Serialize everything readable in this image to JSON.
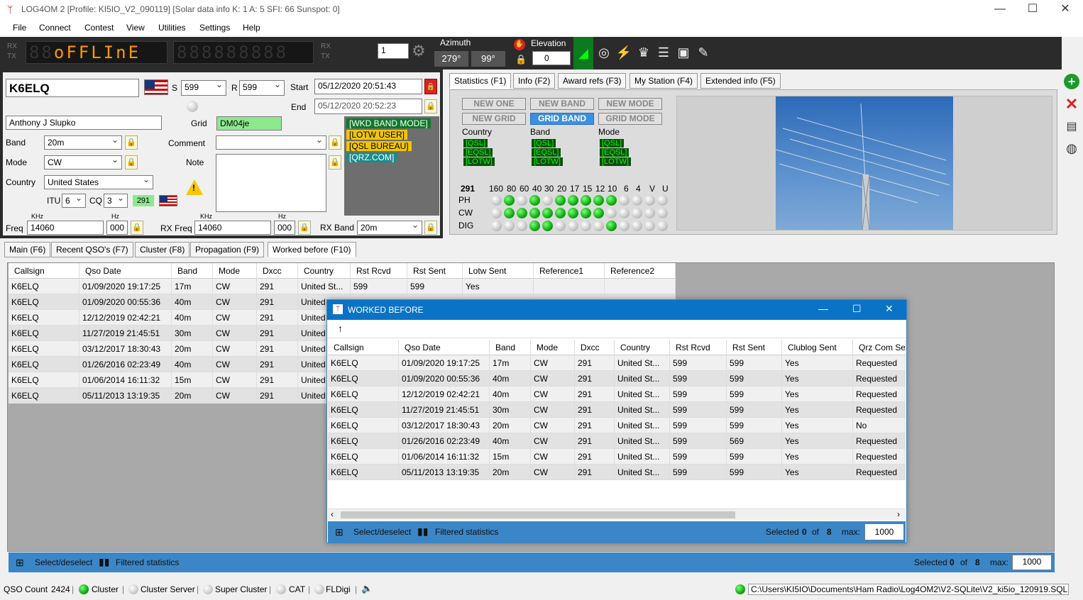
{
  "window": {
    "title": "LOG4OM 2 [Profile: KI5IO_V2_090119] [Solar data info K: 1 A: 5 SFI: 66 Sunspot: 0]"
  },
  "menu": [
    "File",
    "Connect",
    "Contest",
    "View",
    "Utilities",
    "Settings",
    "Help"
  ],
  "toolbar": {
    "rx": "RX",
    "tx": "TX",
    "display1_dim": "88",
    "display1_text": "oFFLInE",
    "display2": "888888888",
    "step_value": "1",
    "azimuth_label": "Azimuth",
    "azimuth_short": "279°",
    "azimuth_long": "99°",
    "elevation_label": "Elevation",
    "elevation_value": "0"
  },
  "qso": {
    "callsign": "K6ELQ",
    "s_label": "S",
    "s_value": "599",
    "r_label": "R",
    "r_value": "599",
    "start_label": "Start",
    "start_value": "05/12/2020 20:51:43",
    "end_label": "End",
    "end_value": "05/12/2020 20:52:23",
    "name": "Anthony J Slupko",
    "grid_label": "Grid",
    "grid_value": "DM04je",
    "band_label": "Band",
    "band_value": "20m",
    "comment_label": "Comment",
    "mode_label": "Mode",
    "mode_value": "CW",
    "note_label": "Note",
    "country_label": "Country",
    "country_value": "United States",
    "itu_label": "ITU",
    "itu_value": "6",
    "cq_label": "CQ",
    "cq_value": "3",
    "dxcc": "291",
    "khz": "KHz",
    "hz": "Hz",
    "freq_label": "Freq",
    "freq_value": "14060",
    "freq_hz": "000",
    "rxfreq_label": "RX Freq",
    "rxfreq_value": "14060",
    "rxfreq_hz": "000",
    "rxband_label": "RX Band",
    "rxband_value": "20m"
  },
  "status_badges": [
    {
      "text": "[WKD BAND MODE]",
      "bg": "#0d7a2a",
      "fg": "#ffffff"
    },
    {
      "text": "[LOTW USER]",
      "bg": "#f2c500",
      "fg": "#000000"
    },
    {
      "text": "[QSL BUREAU]",
      "bg": "#f2c500",
      "fg": "#000000"
    },
    {
      "text": "[QRZ.COM]",
      "bg": "#1a8c8c",
      "fg": "#ffffff"
    }
  ],
  "right_tabs": [
    "Statistics (F1)",
    "Info (F2)",
    "Award refs (F3)",
    "My Station (F4)",
    "Extended info (F5)"
  ],
  "stats": {
    "new_buttons": [
      {
        "label": "NEW ONE",
        "on": false
      },
      {
        "label": "NEW BAND",
        "on": false
      },
      {
        "label": "NEW MODE",
        "on": false
      },
      {
        "label": "NEW GRID",
        "on": false
      },
      {
        "label": "GRID BAND",
        "on": true
      },
      {
        "label": "GRID MODE",
        "on": false
      }
    ],
    "col_labels": [
      "Country",
      "Band",
      "Mode"
    ],
    "qsl_tags": [
      "[QSL]",
      "[EQSL]",
      "[LOTW]"
    ],
    "dxcc": "291",
    "bands": [
      "160",
      "80",
      "60",
      "40",
      "30",
      "20",
      "17",
      "15",
      "12",
      "10",
      "6",
      "4",
      "V",
      "U"
    ],
    "rows": [
      {
        "label": "PH",
        "worked": [
          0,
          1,
          0,
          1,
          0,
          1,
          1,
          1,
          1,
          1,
          0,
          0,
          0,
          0
        ]
      },
      {
        "label": "CW",
        "worked": [
          0,
          1,
          1,
          1,
          1,
          1,
          1,
          1,
          1,
          0,
          0,
          0,
          0,
          0
        ]
      },
      {
        "label": "DIG",
        "worked": [
          0,
          0,
          0,
          1,
          1,
          0,
          0,
          0,
          0,
          1,
          0,
          0,
          0,
          0
        ]
      }
    ]
  },
  "main_tabs": [
    "Main (F6)",
    "Recent QSO's (F7)",
    "Cluster (F8)",
    "Propagation (F9)",
    "Worked before (F10)"
  ],
  "back_table": {
    "headers": [
      "Callsign",
      "Qso Date",
      "Band",
      "Mode",
      "Dxcc",
      "Country",
      "Rst Rcvd",
      "Rst Sent",
      "Lotw Sent",
      "Reference1",
      "Reference2"
    ],
    "rows": [
      [
        "K6ELQ",
        "01/09/2020 19:17:25",
        "17m",
        "CW",
        "291",
        "United St...",
        "599",
        "599",
        "Yes",
        "",
        ""
      ],
      [
        "K6ELQ",
        "01/09/2020 00:55:36",
        "40m",
        "CW",
        "291",
        "United",
        "",
        "",
        "",
        "",
        ""
      ],
      [
        "K6ELQ",
        "12/12/2019 02:42:21",
        "40m",
        "CW",
        "291",
        "United",
        "",
        "",
        "",
        "",
        ""
      ],
      [
        "K6ELQ",
        "11/27/2019 21:45:51",
        "30m",
        "CW",
        "291",
        "United",
        "",
        "",
        "",
        "",
        ""
      ],
      [
        "K6ELQ",
        "03/12/2017 18:30:43",
        "20m",
        "CW",
        "291",
        "United",
        "",
        "",
        "",
        "",
        ""
      ],
      [
        "K6ELQ",
        "01/26/2016 02:23:49",
        "40m",
        "CW",
        "291",
        "United",
        "",
        "",
        "",
        "",
        ""
      ],
      [
        "K6ELQ",
        "01/06/2014 16:11:32",
        "15m",
        "CW",
        "291",
        "United",
        "",
        "",
        "",
        "",
        ""
      ],
      [
        "K6ELQ",
        "05/11/2013 13:19:35",
        "20m",
        "CW",
        "291",
        "United",
        "",
        "",
        "",
        "",
        ""
      ]
    ]
  },
  "back_status": {
    "select": "Select/deselect",
    "filtered": "Filtered statistics",
    "selected_label": "Selected",
    "selected": "0",
    "of": "of",
    "total": "8",
    "max_label": "max:",
    "max": "1000"
  },
  "dialog": {
    "title": "WORKED BEFORE",
    "headers": [
      "Callsign",
      "Qso Date",
      "Band",
      "Mode",
      "Dxcc",
      "Country",
      "Rst Rcvd",
      "Rst Sent",
      "Clublog Sent",
      "Qrz Com Se"
    ],
    "rows": [
      [
        "K6ELQ",
        "01/09/2020 19:17:25",
        "17m",
        "CW",
        "291",
        "United St...",
        "599",
        "599",
        "Yes",
        "Requested"
      ],
      [
        "K6ELQ",
        "01/09/2020 00:55:36",
        "40m",
        "CW",
        "291",
        "United St...",
        "599",
        "599",
        "Yes",
        "Requested"
      ],
      [
        "K6ELQ",
        "12/12/2019 02:42:21",
        "40m",
        "CW",
        "291",
        "United St...",
        "599",
        "599",
        "Yes",
        "Requested"
      ],
      [
        "K6ELQ",
        "11/27/2019 21:45:51",
        "30m",
        "CW",
        "291",
        "United St...",
        "599",
        "599",
        "Yes",
        "Requested"
      ],
      [
        "K6ELQ",
        "03/12/2017 18:30:43",
        "20m",
        "CW",
        "291",
        "United St...",
        "599",
        "599",
        "Yes",
        "No"
      ],
      [
        "K6ELQ",
        "01/26/2016 02:23:49",
        "40m",
        "CW",
        "291",
        "United St...",
        "599",
        "569",
        "Yes",
        "Requested"
      ],
      [
        "K6ELQ",
        "01/06/2014 16:11:32",
        "15m",
        "CW",
        "291",
        "United St...",
        "599",
        "599",
        "Yes",
        "Requested"
      ],
      [
        "K6ELQ",
        "05/11/2013 13:19:35",
        "20m",
        "CW",
        "291",
        "United St...",
        "599",
        "599",
        "Yes",
        "Requested"
      ]
    ],
    "status": {
      "select": "Select/deselect",
      "filtered": "Filtered statistics",
      "selected_label": "Selected",
      "selected": "0",
      "of": "of",
      "total": "8",
      "max_label": "max:",
      "max": "1000"
    }
  },
  "bottom": {
    "qso_count_label": "QSO Count",
    "qso_count": "2424",
    "items": [
      "Cluster",
      "Cluster Server",
      "Super Cluster",
      "CAT",
      "FLDigi"
    ],
    "db_path": "C:\\Users\\KI5IO\\Documents\\Ham Radio\\Log4OM2\\V2-SQLite\\V2_ki5io_120919.SQLite"
  },
  "colors": {
    "accent": "#0a73c6",
    "status_blue": "#3b86c6",
    "grid_green": "#8ee88e",
    "badge_green": "#0d7a2a"
  }
}
